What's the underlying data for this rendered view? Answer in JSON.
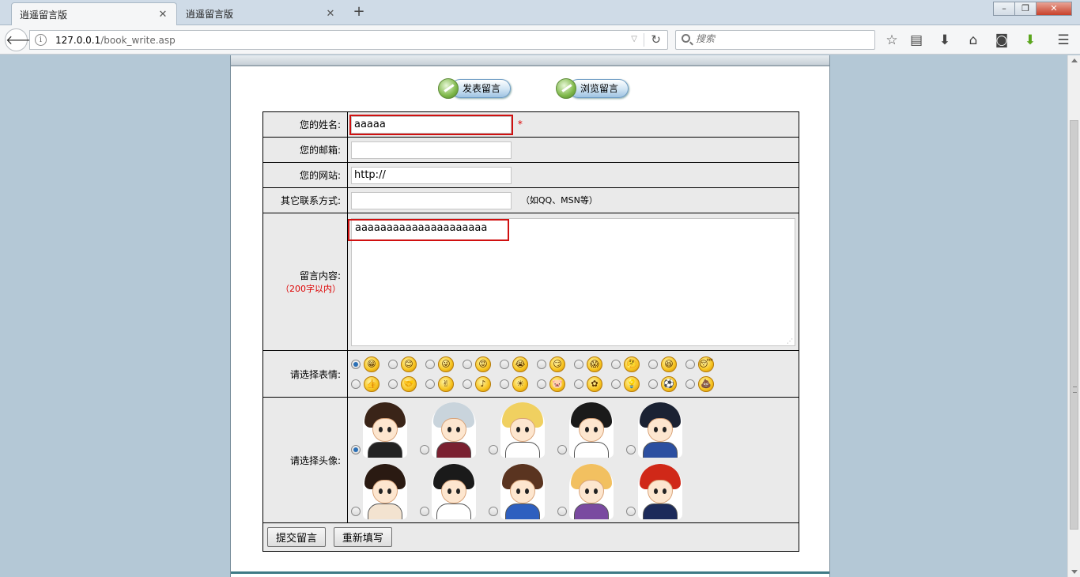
{
  "browser": {
    "tabs": [
      {
        "title": "逍遥留言版",
        "active": true
      },
      {
        "title": "逍遥留言版",
        "active": false
      }
    ],
    "url_host": "127.0.0.1",
    "url_path": "/book_write.asp",
    "search_placeholder": "搜索",
    "window_buttons": {
      "minimize": "–",
      "restore": "❐",
      "close": "✕"
    }
  },
  "nav": {
    "write_label": "发表留言",
    "browse_label": "浏览留言"
  },
  "form": {
    "name": {
      "label": "您的姓名:",
      "value": "aaaaa",
      "required_mark": "*"
    },
    "email": {
      "label": "您的邮箱:",
      "value": ""
    },
    "website": {
      "label": "您的网站:",
      "value": "http://"
    },
    "other_contact": {
      "label": "其它联系方式:",
      "value": "",
      "hint": "（如QQ、MSN等）"
    },
    "content": {
      "label": "留言内容:",
      "note": "（200字以内）",
      "value": "aaaaaaaaaaaaaaaaaaaaa"
    },
    "emoticon": {
      "label": "请选择表情:",
      "selected_index": 0,
      "items": [
        {
          "icon": "grin-face-icon",
          "glyph": "😁"
        },
        {
          "icon": "smile-face-icon",
          "glyph": "😊"
        },
        {
          "icon": "tongue-face-icon",
          "glyph": "😜"
        },
        {
          "icon": "angry-face-icon",
          "glyph": "😡"
        },
        {
          "icon": "cry-face-icon",
          "glyph": "😭"
        },
        {
          "icon": "smirk-face-icon",
          "glyph": "😏"
        },
        {
          "icon": "shocked-face-icon",
          "glyph": "😱"
        },
        {
          "icon": "thinking-face-icon",
          "glyph": "🤔"
        },
        {
          "icon": "laugh-face-icon",
          "glyph": "😆"
        },
        {
          "icon": "sleepy-face-icon",
          "glyph": "😴"
        },
        {
          "icon": "thumbs-up-icon",
          "glyph": "👍"
        },
        {
          "icon": "handshake-icon",
          "glyph": "🤝"
        },
        {
          "icon": "victory-hand-icon",
          "glyph": "✌"
        },
        {
          "icon": "music-note-icon",
          "glyph": "♪"
        },
        {
          "icon": "sun-icon",
          "glyph": "☀"
        },
        {
          "icon": "pig-face-icon",
          "glyph": "🐷"
        },
        {
          "icon": "flower-icon",
          "glyph": "✿"
        },
        {
          "icon": "light-bulb-icon",
          "glyph": "💡"
        },
        {
          "icon": "soccer-ball-icon",
          "glyph": "⚽"
        },
        {
          "icon": "poop-icon",
          "glyph": "💩"
        }
      ]
    },
    "avatar": {
      "label": "请选择头像:",
      "selected_index": 0,
      "items": [
        {
          "hair": "#3a2418",
          "body": "#222222"
        },
        {
          "hair": "#c9d4dc",
          "body": "#7a2030"
        },
        {
          "hair": "#f0d060",
          "body": "#ffffff"
        },
        {
          "hair": "#1a1a1a",
          "body": "#ffffff"
        },
        {
          "hair": "#1b2233",
          "body": "#2c4fa0"
        },
        {
          "hair": "#2a1a12",
          "body": "#f3e3d0"
        },
        {
          "hair": "#1a1a1a",
          "body": "#ffffff"
        },
        {
          "hair": "#5a3420",
          "body": "#2e5fbf"
        },
        {
          "hair": "#f2c060",
          "body": "#7a4aa0"
        },
        {
          "hair": "#d02818",
          "body": "#1c2a5a"
        }
      ]
    },
    "submit_label": "提交留言",
    "reset_label": "重新填写"
  }
}
